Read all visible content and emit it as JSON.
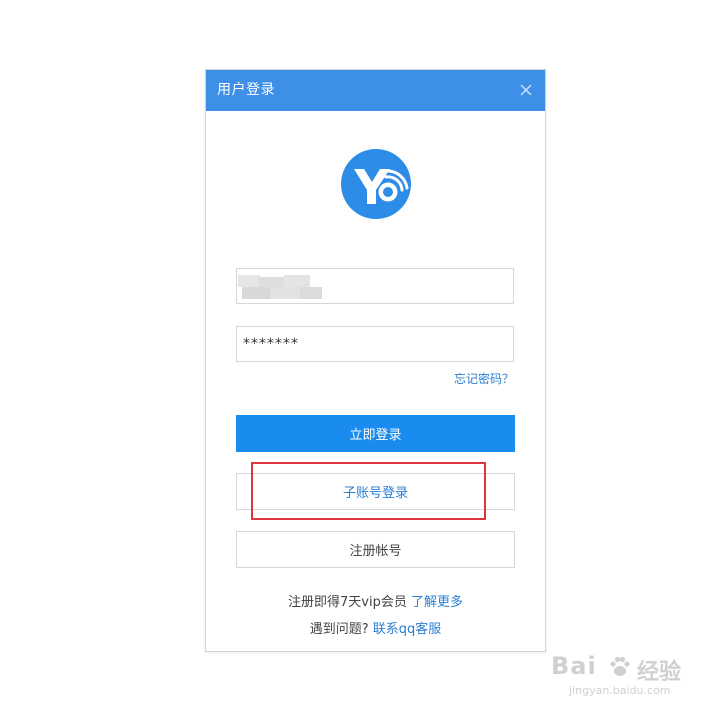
{
  "dialog": {
    "title": "用户登录",
    "username_value": "",
    "password_value": "*******",
    "forgot_label": "忘记密码？",
    "login_label": "立即登录",
    "subaccount_label": "子账号登录",
    "register_label": "注册帐号",
    "promo_text": "注册即得7天vip会员",
    "promo_link": "了解更多",
    "help_text": "遇到问题?",
    "help_link": "联系qq客服"
  },
  "icons": {
    "close": "close-icon",
    "logo": "app-logo-icon"
  },
  "watermark": {
    "brand": "Bai",
    "brand_cn": "经验",
    "url": "jingyan.baidu.com"
  },
  "colors": {
    "titlebar": "#3d8fe8",
    "primary_button": "#1a8cf0",
    "link": "#2a7fd4",
    "highlight": "#d9363e"
  }
}
